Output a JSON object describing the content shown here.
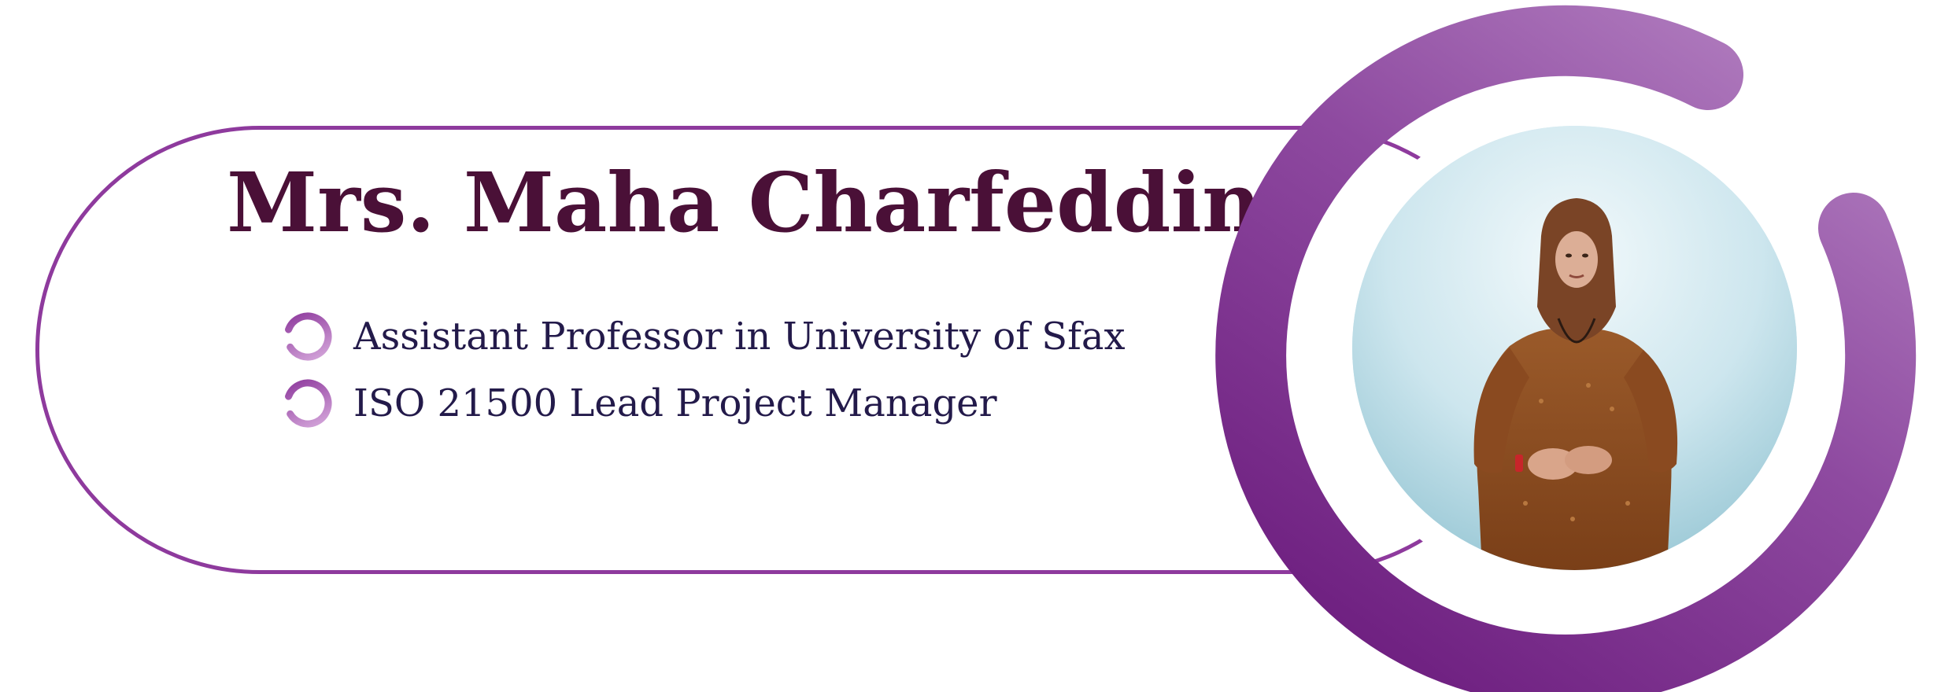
{
  "profile": {
    "name": "Mrs. Maha Charfeddine",
    "roles": [
      "Assistant Professor in University of Sfax",
      "ISO 21500 Lead Project Manager"
    ]
  },
  "colors": {
    "outline": "#8e3a9d",
    "name_text": "#4a1037",
    "role_text": "#231a4a",
    "ring_dark": "#7a2a8a",
    "ring_light": "#b07bbf"
  },
  "icons": {
    "bullet": "circular-swirl-icon"
  }
}
